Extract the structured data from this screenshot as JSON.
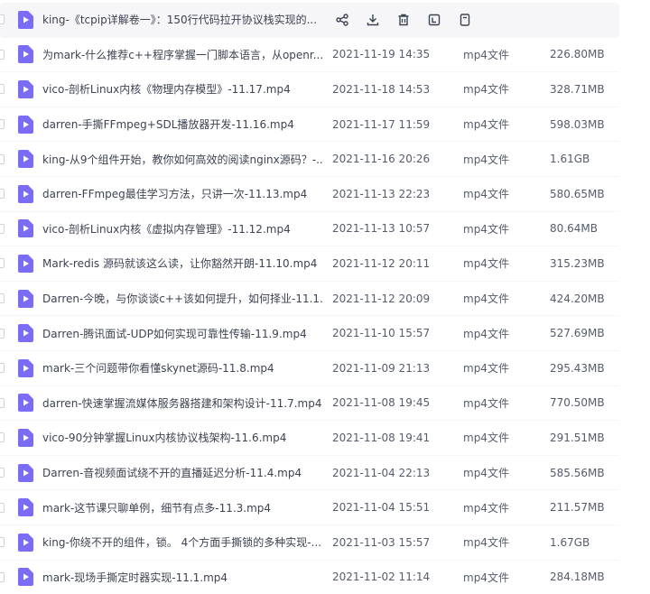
{
  "files": [
    {
      "name": "king-《tcpip详解卷一》：150行代码拉开协议栈实现的...",
      "date": "",
      "type": "",
      "size": "",
      "hovered": true
    },
    {
      "name": "为mark-什么推荐c++程序掌握一门脚本语言，从openr...",
      "date": "2021-11-19 14:35",
      "type": "mp4文件",
      "size": "226.80MB"
    },
    {
      "name": "vico-剖析Linux内核《物理内存模型》-11.17.mp4",
      "date": "2021-11-18 14:53",
      "type": "mp4文件",
      "size": "328.71MB"
    },
    {
      "name": "darren-手撕FFmpeg+SDL播放器开发-11.16.mp4",
      "date": "2021-11-17 11:59",
      "type": "mp4文件",
      "size": "598.03MB"
    },
    {
      "name": "king-从9个组件开始，教你如何高效的阅读nginx源码？-...",
      "date": "2021-11-16 20:26",
      "type": "mp4文件",
      "size": "1.61GB"
    },
    {
      "name": "darren-FFmpeg最佳学习方法，只讲一次-11.13.mp4",
      "date": "2021-11-13 22:23",
      "type": "mp4文件",
      "size": "580.65MB"
    },
    {
      "name": "vico-剖析Linux内核《虚拟内存管理》-11.12.mp4",
      "date": "2021-11-13 10:57",
      "type": "mp4文件",
      "size": "80.64MB"
    },
    {
      "name": "Mark-redis 源码就该这么读，让你豁然开朗-11.10.mp4",
      "date": "2021-11-12 20:11",
      "type": "mp4文件",
      "size": "315.23MB"
    },
    {
      "name": "Darren-今晚，与你谈谈c++该如何提升，如何择业-11.1...",
      "date": "2021-11-12 20:09",
      "type": "mp4文件",
      "size": "424.20MB"
    },
    {
      "name": "Darren-腾讯面试-UDP如何实现可靠性传输-11.9.mp4",
      "date": "2021-11-10 15:57",
      "type": "mp4文件",
      "size": "527.69MB"
    },
    {
      "name": "mark-三个问题带你看懂skynet源码-11.8.mp4",
      "date": "2021-11-09 21:13",
      "type": "mp4文件",
      "size": "295.43MB"
    },
    {
      "name": "darren-快速掌握流媒体服务器搭建和架构设计-11.7.mp4",
      "date": "2021-11-08 19:45",
      "type": "mp4文件",
      "size": "770.50MB"
    },
    {
      "name": "vico-90分钟掌握Linux内核协议栈架构-11.6.mp4",
      "date": "2021-11-08 19:41",
      "type": "mp4文件",
      "size": "291.51MB"
    },
    {
      "name": "Darren-音视频面试绕不开的直播延迟分析-11.4.mp4",
      "date": "2021-11-04 22:13",
      "type": "mp4文件",
      "size": "585.56MB"
    },
    {
      "name": "mark-这节课只聊单例，细节有点多-11.3.mp4",
      "date": "2021-11-04 15:51",
      "type": "mp4文件",
      "size": "211.57MB"
    },
    {
      "name": "king-你绕不开的组件，锁。 4个方面手撕锁的多种实现-...",
      "date": "2021-11-03 15:57",
      "type": "mp4文件",
      "size": "1.67GB"
    },
    {
      "name": "mark-现场手撕定时器实现-11.1.mp4",
      "date": "2021-11-02 11:14",
      "type": "mp4文件",
      "size": "284.18MB"
    }
  ],
  "hover_actions": [
    {
      "name": "share-button",
      "icon": "share-icon"
    },
    {
      "name": "download-button",
      "icon": "download-icon"
    },
    {
      "name": "delete-button",
      "icon": "trash-icon"
    },
    {
      "name": "rename-button",
      "icon": "rename-icon"
    },
    {
      "name": "more-button",
      "icon": "document-icon"
    }
  ],
  "colors": {
    "icon_purple": "#7b6cf6",
    "hover_bg": "#f6f6f8",
    "text_primary": "#3d4352",
    "text_secondary": "#555c6b"
  }
}
